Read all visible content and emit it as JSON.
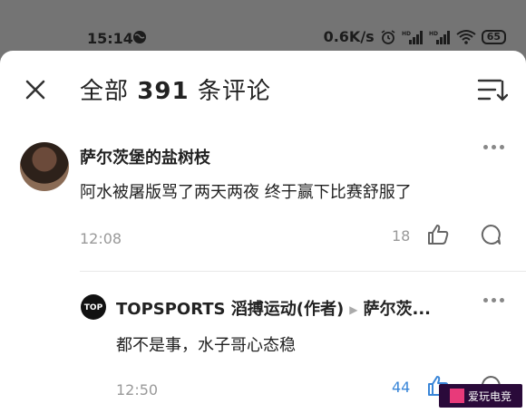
{
  "status_bar": {
    "time": "15:14",
    "network_speed": "0.6K/s",
    "battery": "65",
    "signal_labels": [
      "HD",
      "HD"
    ]
  },
  "comments_sheet": {
    "title_prefix": "全部",
    "title_count": "391",
    "title_suffix": "条评论",
    "close_icon": "close-icon",
    "sort_icon": "sort-icon"
  },
  "comments": [
    {
      "username": "萨尔茨堡的盐树枝",
      "text": "阿水被屠版骂了两天两夜 终于赢下比赛舒服了",
      "time": "12:08",
      "likes": "18"
    }
  ],
  "replies": [
    {
      "author": "TOPSPORTS 滔搏运动(作者)",
      "reply_to": "萨尔茨...",
      "text": "都不是事，水子哥心态稳",
      "time": "12:50",
      "likes": "44",
      "avatar_text": "TOP"
    }
  ],
  "watermark": {
    "text": "爱玩电竞"
  },
  "colors": {
    "accent_blue": "#3a86d8",
    "muted": "#999999",
    "text": "#222222",
    "overlay": "#747474"
  }
}
